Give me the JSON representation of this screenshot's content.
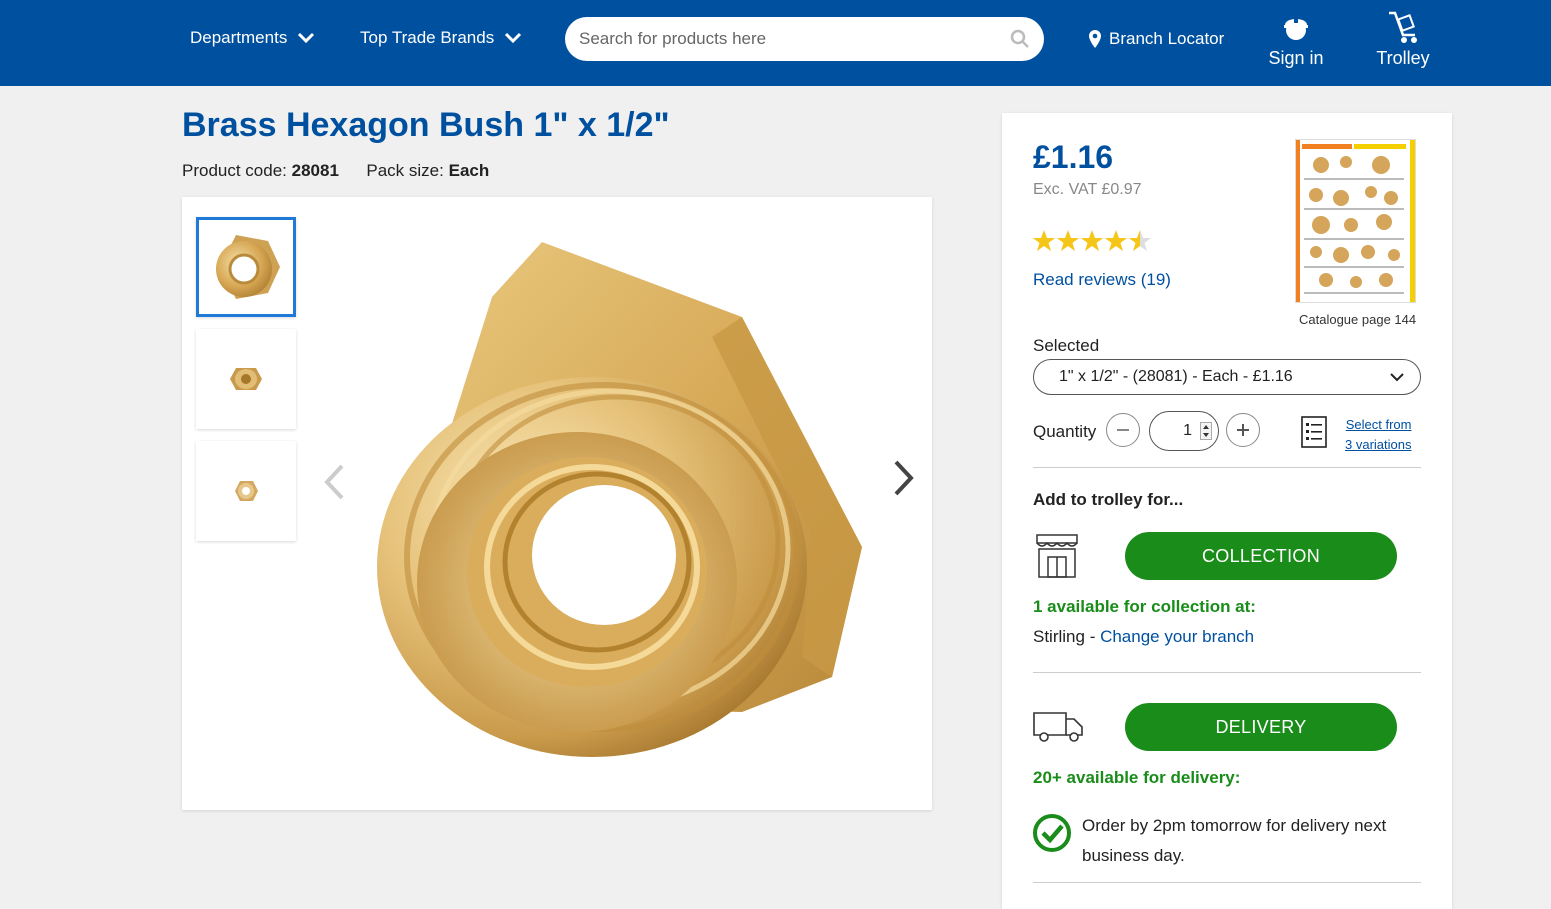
{
  "header": {
    "departments": "Departments",
    "top_trade_brands": "Top Trade Brands",
    "search_placeholder": "Search for products here",
    "branch_locator": "Branch Locator",
    "sign_in": "Sign in",
    "trolley": "Trolley"
  },
  "product": {
    "title": "Brass Hexagon Bush 1\" x 1/2\"",
    "code_label": "Product code:",
    "code": "28081",
    "pack_label": "Pack size:",
    "pack": "Each"
  },
  "buy": {
    "price": "£1.16",
    "ex_vat": "Exc. VAT £0.97",
    "rating": 4.5,
    "rating_max": 5,
    "reviews_link": "Read reviews (19)",
    "catalogue_label": "Catalogue page 144",
    "selected_label": "Selected",
    "selected_value": "1\" x 1/2\" - (28081) - Each - £1.16",
    "quantity_label": "Quantity",
    "quantity": "1",
    "variations_line1": "Select from",
    "variations_line2": "3 variations",
    "add_to_trolley": "Add to trolley for...",
    "collection_button": "COLLECTION",
    "collection_avail": "1 available for collection at:",
    "branch_name": "Stirling",
    "branch_sep": " - ",
    "change_branch": "Change your branch",
    "delivery_button": "DELIVERY",
    "delivery_avail": "20+ available for delivery:",
    "order_note": "Order by 2pm tomorrow for delivery next business day."
  },
  "colors": {
    "brand_blue": "#0050a0",
    "action_green": "#1a8c1a",
    "star_gold": "#f5c518"
  }
}
